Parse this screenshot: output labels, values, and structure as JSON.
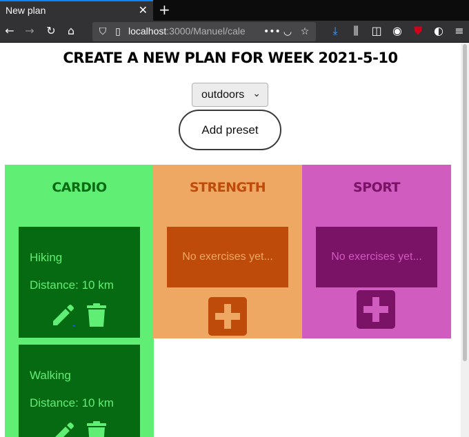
{
  "browser": {
    "tab_title": "New plan",
    "tab_close": "✕",
    "new_tab": "+",
    "url_host": "localhost",
    "url_rest": ":3000/Manuel/cale",
    "url_more": "•••"
  },
  "page": {
    "title": "CREATE A NEW PLAN FOR WEEK 2021-5-10",
    "select_value": "outdoors",
    "preset_button": "Add preset"
  },
  "columns": [
    {
      "title": "CARDIO",
      "color": "#60ee74",
      "items": [
        {
          "name": "Hiking",
          "distance": "Distance: 10 km"
        },
        {
          "name": "Walking",
          "distance": "Distance: 10 km"
        }
      ]
    },
    {
      "title": "STRENGTH",
      "color": "#eea864",
      "empty_text": "No exercises yet..."
    },
    {
      "title": "SPORT",
      "color": "#d05cc0",
      "empty_text": "No exercises yet..."
    }
  ],
  "icons": {
    "edit": "pencil-icon",
    "delete": "trash-icon",
    "add": "plus-icon"
  }
}
